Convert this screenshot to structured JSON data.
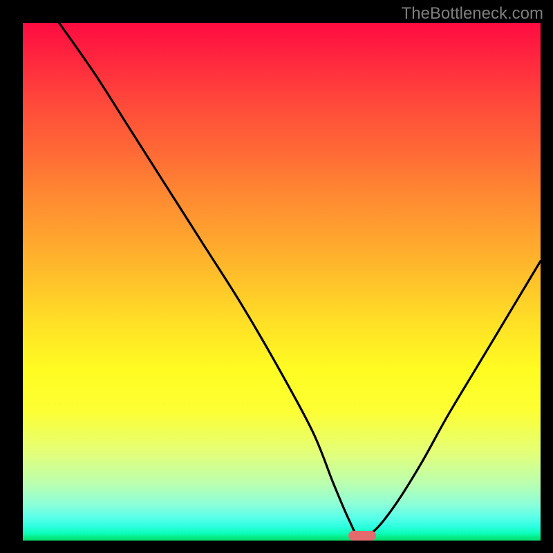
{
  "watermark": "TheBottleneck.com",
  "chart_data": {
    "type": "line",
    "title": "",
    "xlabel": "",
    "ylabel": "",
    "xlim": [
      0,
      100
    ],
    "ylim": [
      0,
      100
    ],
    "series": [
      {
        "name": "bottleneck-curve",
        "x": [
          7,
          14,
          21,
          28,
          35,
          42,
          49,
          56,
          60,
          63,
          65,
          68,
          72,
          77,
          82,
          88,
          94,
          100
        ],
        "y": [
          100,
          90,
          79,
          68,
          57,
          46,
          34,
          21,
          11,
          4,
          0.7,
          2,
          7,
          15,
          24,
          34,
          44,
          54
        ]
      }
    ],
    "marker": {
      "x": 65.5,
      "y": 0.9
    },
    "gradient_top_color": "#ff0b41",
    "gradient_bottom_color": "#08de6f",
    "curve_color": "#000000",
    "marker_color": "#e46a6e"
  }
}
